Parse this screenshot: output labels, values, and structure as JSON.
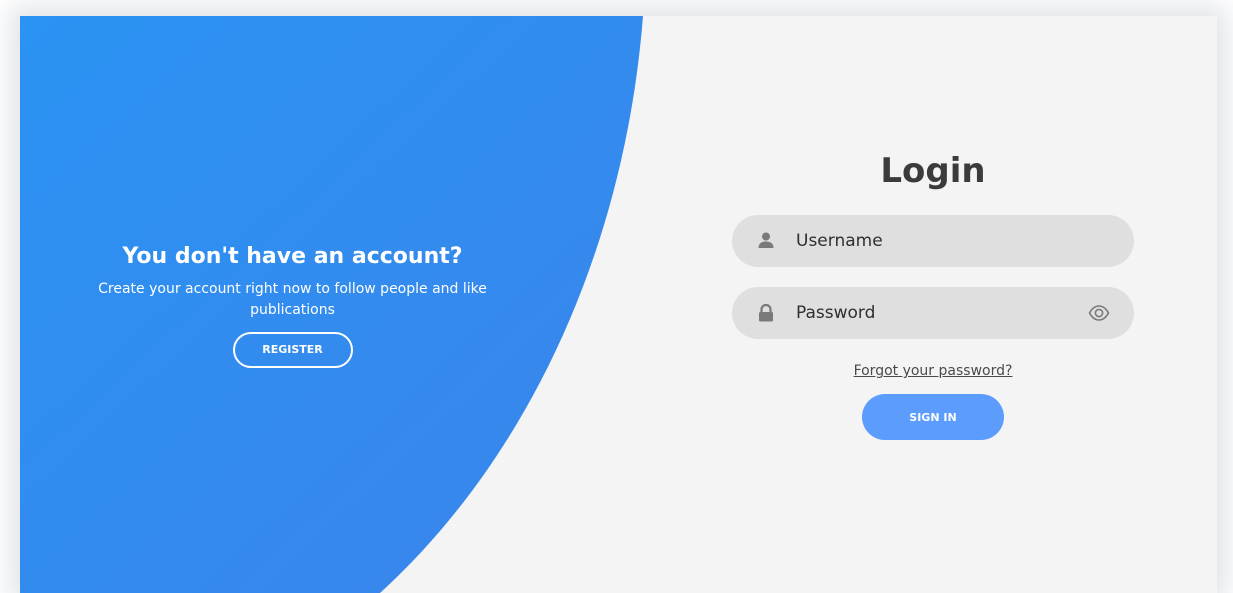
{
  "colors": {
    "panel_gradient_start": "#2a92f2",
    "panel_gradient_end": "#3a86ec",
    "background": "#f4f4f5",
    "field_background": "#dfdfdf",
    "sign_in_button": "#5b9cfd",
    "heading_text": "#3b3b3b"
  },
  "register_panel": {
    "title": "You don't have an account?",
    "subtitle": "Create your account right now to follow people and like publications",
    "register_label": "REGISTER"
  },
  "login_form": {
    "title": "Login",
    "username": {
      "value": "",
      "placeholder": "Username",
      "icon": "user-icon"
    },
    "password": {
      "value": "",
      "placeholder": "Password",
      "icon": "lock-icon",
      "toggle_icon": "eye-icon"
    },
    "forgot_label": "Forgot your password?",
    "sign_in_label": "SIGN IN"
  }
}
